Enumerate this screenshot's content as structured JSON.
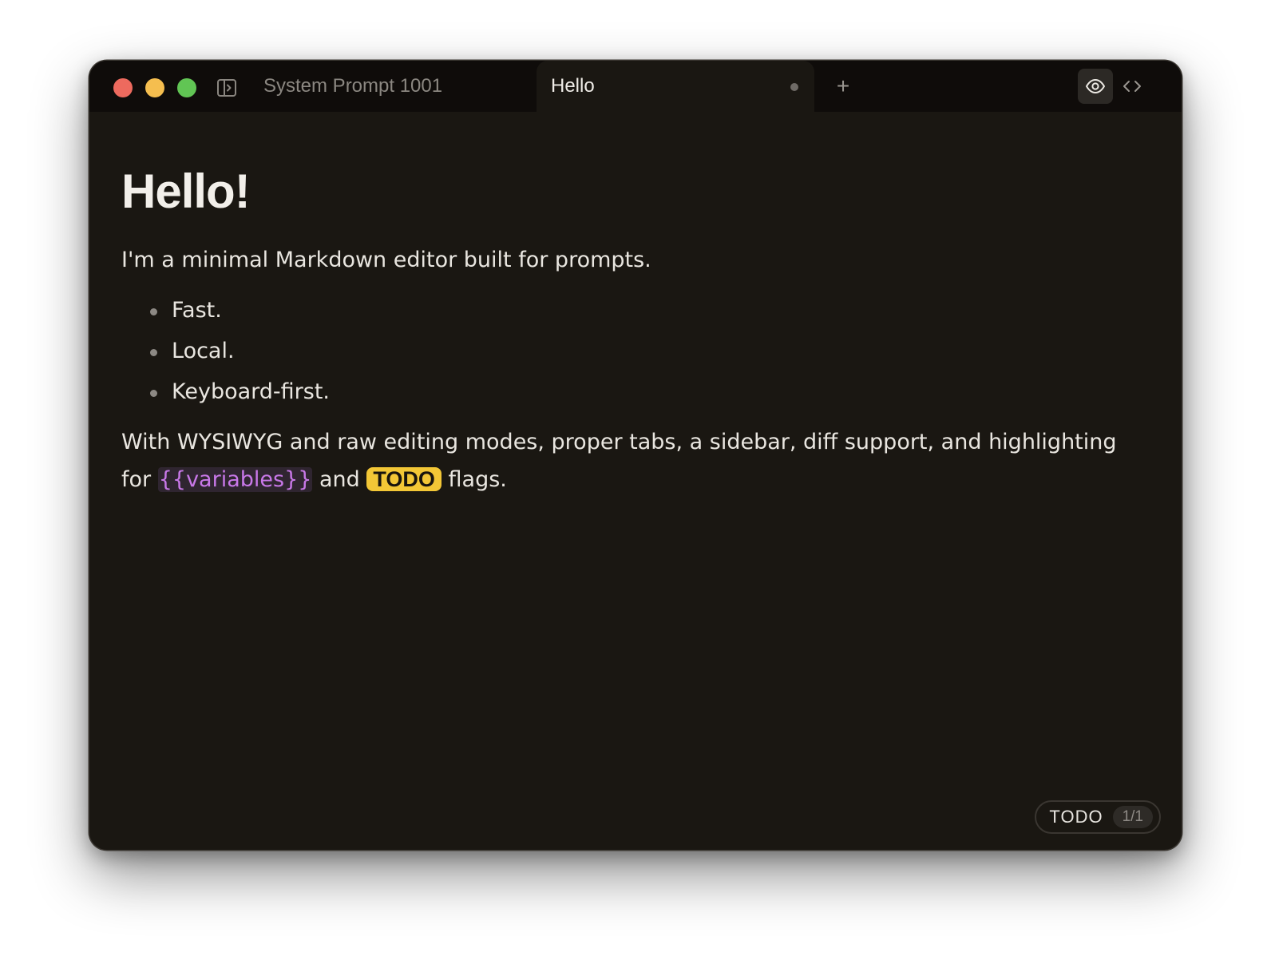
{
  "window": {
    "controls": [
      "close",
      "minimize",
      "maximize"
    ],
    "sidebar_toggle_icon": "sidebar-toggle-icon"
  },
  "tabs": [
    {
      "label": "System Prompt 1001",
      "active": false
    },
    {
      "label": "Hello",
      "active": true,
      "unsaved": true
    }
  ],
  "toolbar": {
    "new_tab_label": "+",
    "preview_icon": "eye-icon",
    "code_icon": "code-icon"
  },
  "document": {
    "heading": "Hello!",
    "intro": "I'm a minimal Markdown editor built for prompts.",
    "bullets": [
      "Fast.",
      "Local.",
      "Keyboard-first."
    ],
    "closing_text": "With WYSIWYG and raw editing modes, proper tabs, a sidebar, diff support, and highlighting for",
    "variable_token": "{{variables}}",
    "and_text": "and",
    "todo_token": "TODO",
    "flags_text": "flags."
  },
  "todo_counter": {
    "label": "TODO",
    "count": "1/1"
  },
  "colors": {
    "background": "#1a1712",
    "titlebar": "#0f0c0a",
    "variable": "#c878e8",
    "todo_highlight": "#f3c736"
  }
}
